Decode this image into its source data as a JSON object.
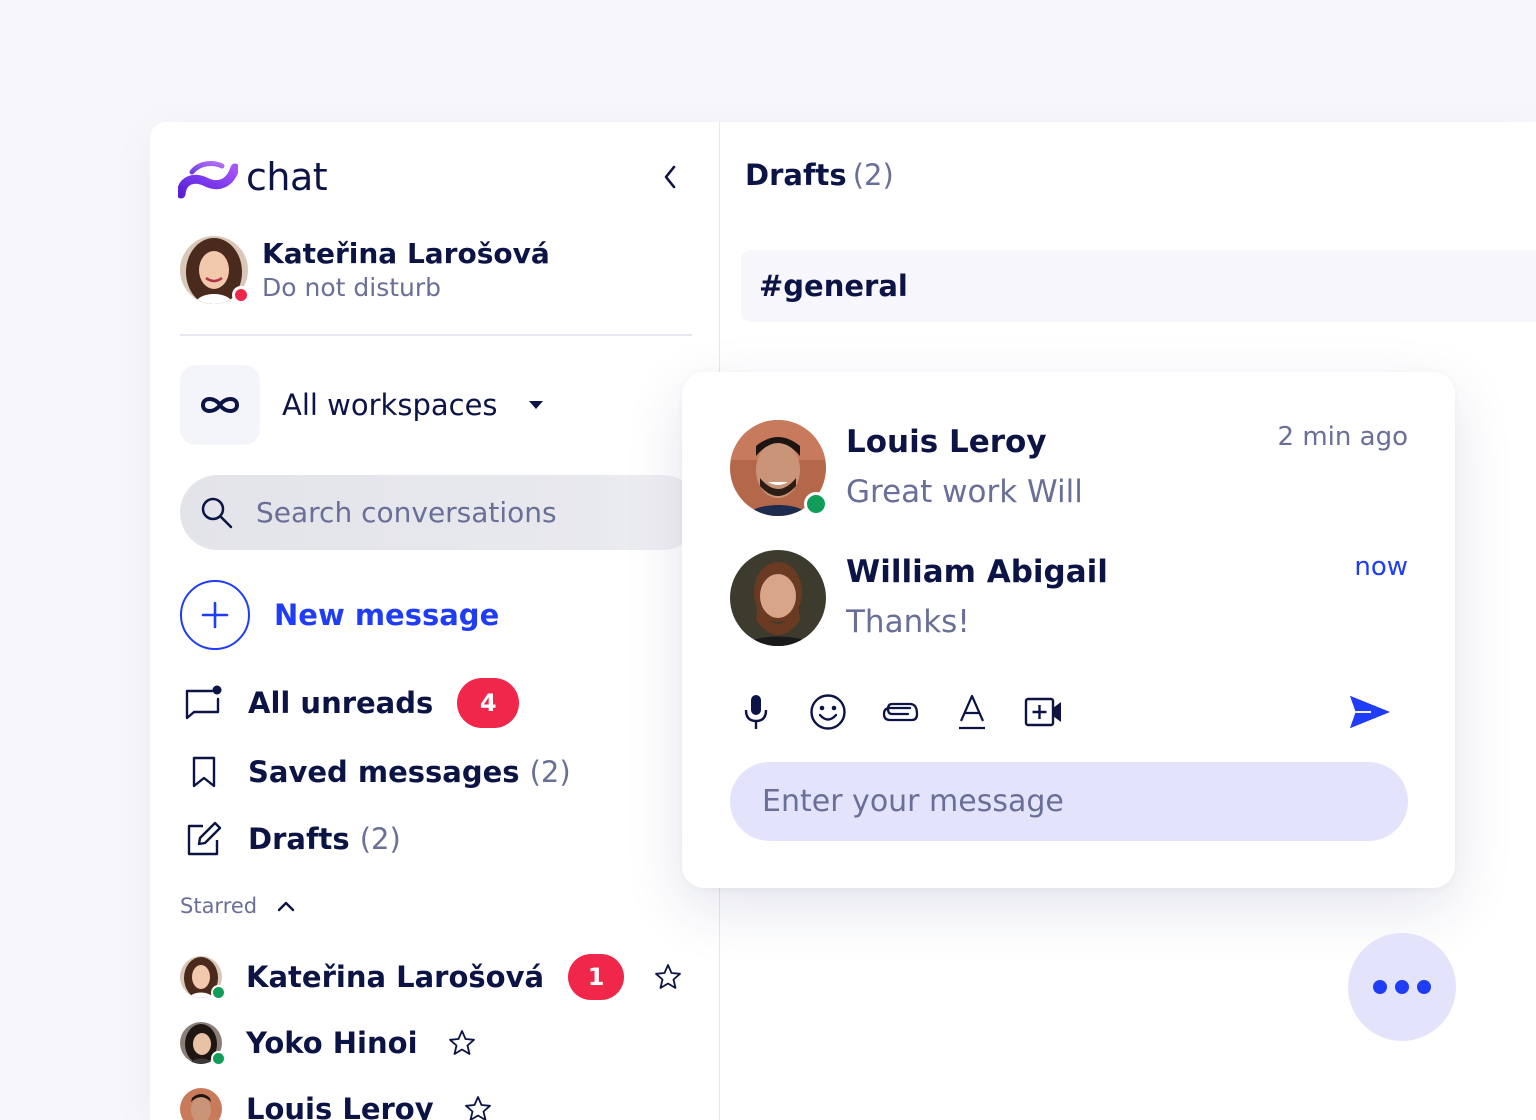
{
  "app": {
    "logo_text": "chat"
  },
  "profile": {
    "name": "Kateřina Larošová",
    "status": "Do not disturb",
    "status_color": "#f0264a"
  },
  "workspace": {
    "label": "All workspaces",
    "icon": "infinity-icon"
  },
  "search": {
    "placeholder": "Search conversations"
  },
  "new_message": {
    "label": "New message"
  },
  "nav": {
    "unreads": {
      "label": "All unreads",
      "badge": "4",
      "icon": "chat-bubble-icon"
    },
    "saved": {
      "label": "Saved messages",
      "count": "(2)",
      "icon": "bookmark-icon"
    },
    "drafts": {
      "label": "Drafts",
      "count": "(2)",
      "icon": "edit-icon"
    }
  },
  "starred": {
    "label": "Starred",
    "items": [
      {
        "name": "Kateřina Larošová",
        "badge": "1"
      },
      {
        "name": "Yoko Hinoi"
      },
      {
        "name": "Louis Leroy"
      }
    ]
  },
  "main": {
    "title": "Drafts",
    "count": "(2)",
    "channel": "#general"
  },
  "thread": {
    "messages": [
      {
        "name": "Louis Leroy",
        "text": "Great work Will",
        "time": "2 min ago"
      },
      {
        "name": "William Abigail",
        "text": "Thanks!",
        "time": "now"
      }
    ],
    "composer_placeholder": "Enter your message"
  },
  "colors": {
    "accent": "#1e3df5",
    "text_primary": "#0c1445",
    "text_secondary": "#6a6f97",
    "badge": "#f0264a",
    "online": "#0f9d58",
    "composer_bg": "#e3e4fb"
  }
}
